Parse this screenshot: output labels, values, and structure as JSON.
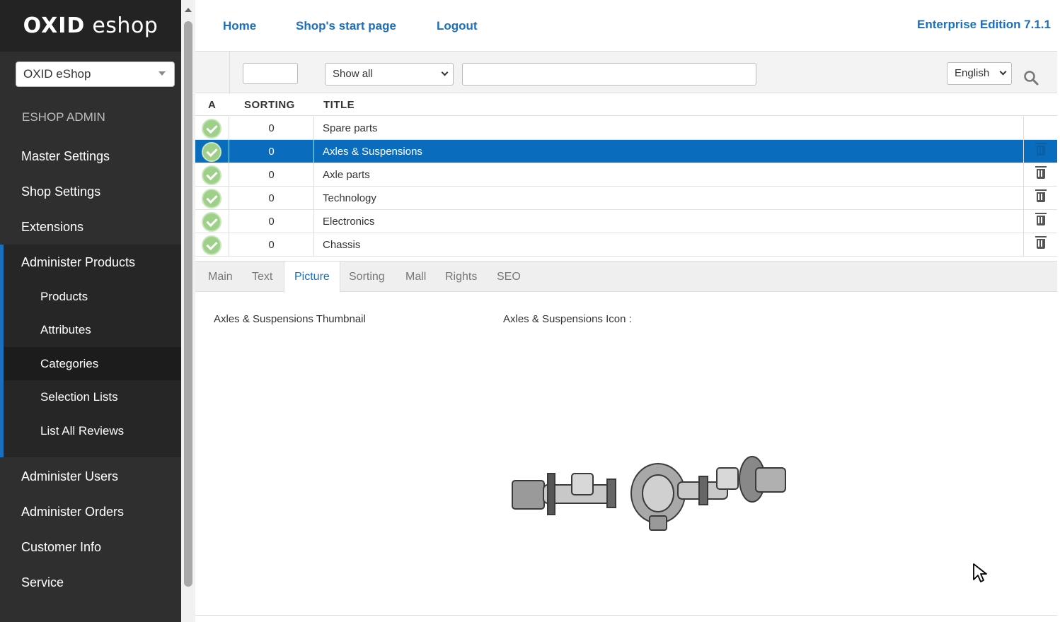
{
  "sidebar": {
    "logo_bold": "OXID",
    "logo_light": "eshop",
    "shop_selector": "OXID eShop",
    "section_title": "ESHOP ADMIN",
    "items": [
      "Master Settings",
      "Shop Settings",
      "Extensions",
      "Administer Products"
    ],
    "submenu": [
      "Products",
      "Attributes",
      "Categories",
      "Selection Lists",
      "List All Reviews"
    ],
    "active_submenu": "Categories",
    "items_bottom": [
      "Administer Users",
      "Administer Orders",
      "Customer Info",
      "Service"
    ]
  },
  "header": {
    "links": [
      "Home",
      "Shop's start page",
      "Logout"
    ],
    "edition": "Enterprise Edition 7.1.1"
  },
  "filters": {
    "sorting_value": "",
    "status_select": "Show all",
    "title_value": "",
    "language_select": "English"
  },
  "table": {
    "headers": [
      "A",
      "SORTING",
      "TITLE"
    ],
    "rows": [
      {
        "sorting": "0",
        "title": "Spare parts"
      },
      {
        "sorting": "0",
        "title": "Axles & Suspensions"
      },
      {
        "sorting": "0",
        "title": "Axle parts"
      },
      {
        "sorting": "0",
        "title": "Technology"
      },
      {
        "sorting": "0",
        "title": "Electronics"
      },
      {
        "sorting": "0",
        "title": "Chassis"
      }
    ],
    "selected_row": "Axles & Suspensions"
  },
  "tabs": [
    "Main",
    "Text",
    "Picture",
    "Sorting",
    "Mall",
    "Rights",
    "SEO"
  ],
  "active_tab": "Picture",
  "picture": {
    "thumbnail_label": "Axles & Suspensions Thumbnail",
    "icon_label": "Axles & Suspensions Icon :"
  },
  "colors": {
    "sidebar_bg": "#2f2f2f",
    "accent": "#1a6fbf",
    "selected_row": "#0a6cbc"
  }
}
